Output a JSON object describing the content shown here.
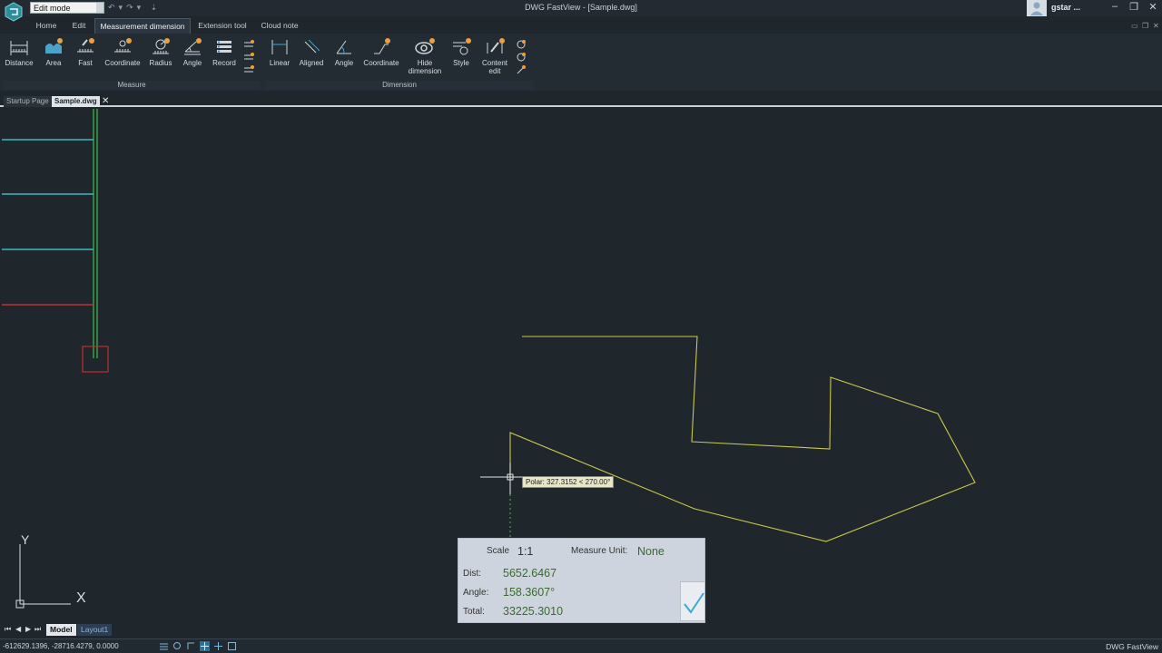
{
  "window": {
    "title": "DWG FastView - [Sample.dwg]",
    "mode_select": "Edit mode",
    "user_name": "gstar ..."
  },
  "ribbon_tabs": [
    "Home",
    "Edit",
    "Measurement dimension",
    "Extension tool",
    "Cloud note"
  ],
  "ribbon": {
    "measure_group": {
      "title": "Measure",
      "buttons": [
        "Distance",
        "Area",
        "Fast",
        "Coordinate",
        "Radius",
        "Angle",
        "Record"
      ]
    },
    "dimension_group": {
      "title": "Dimension",
      "buttons": [
        "Linear",
        "Aligned",
        "Angle",
        "Coordinate",
        "Hide dimension",
        "Style",
        "Content edit"
      ]
    }
  },
  "doc_tabs": [
    "Startup Page",
    "Sample.dwg"
  ],
  "canvas": {
    "polar_tooltip": "Polar: 327.3152 < 270.00°",
    "ucs_x": "X",
    "ucs_y": "Y"
  },
  "measure_panel": {
    "scale_label": "Scale",
    "scale_value": "1:1",
    "unit_label": "Measure Unit:",
    "unit_value": "None",
    "dist_label": "Dist:",
    "dist_value": "5652.6467",
    "angle_label": "Angle:",
    "angle_value": "158.3607°",
    "total_label": "Total:",
    "total_value": "33225.3010"
  },
  "layout_tabs": [
    "Model",
    "Layout1"
  ],
  "status": {
    "coordinates": "-612629.1396, -28716.4279, 0.0000",
    "app_name": "DWG FastView"
  },
  "colors": {
    "canvas_bg": "#1f262c",
    "polyline": "#c9c94a",
    "cyan_line": "#3fb8c0",
    "green_line": "#3fbf4a",
    "red_line": "#c03030",
    "value_green": "#3a6a2e"
  }
}
